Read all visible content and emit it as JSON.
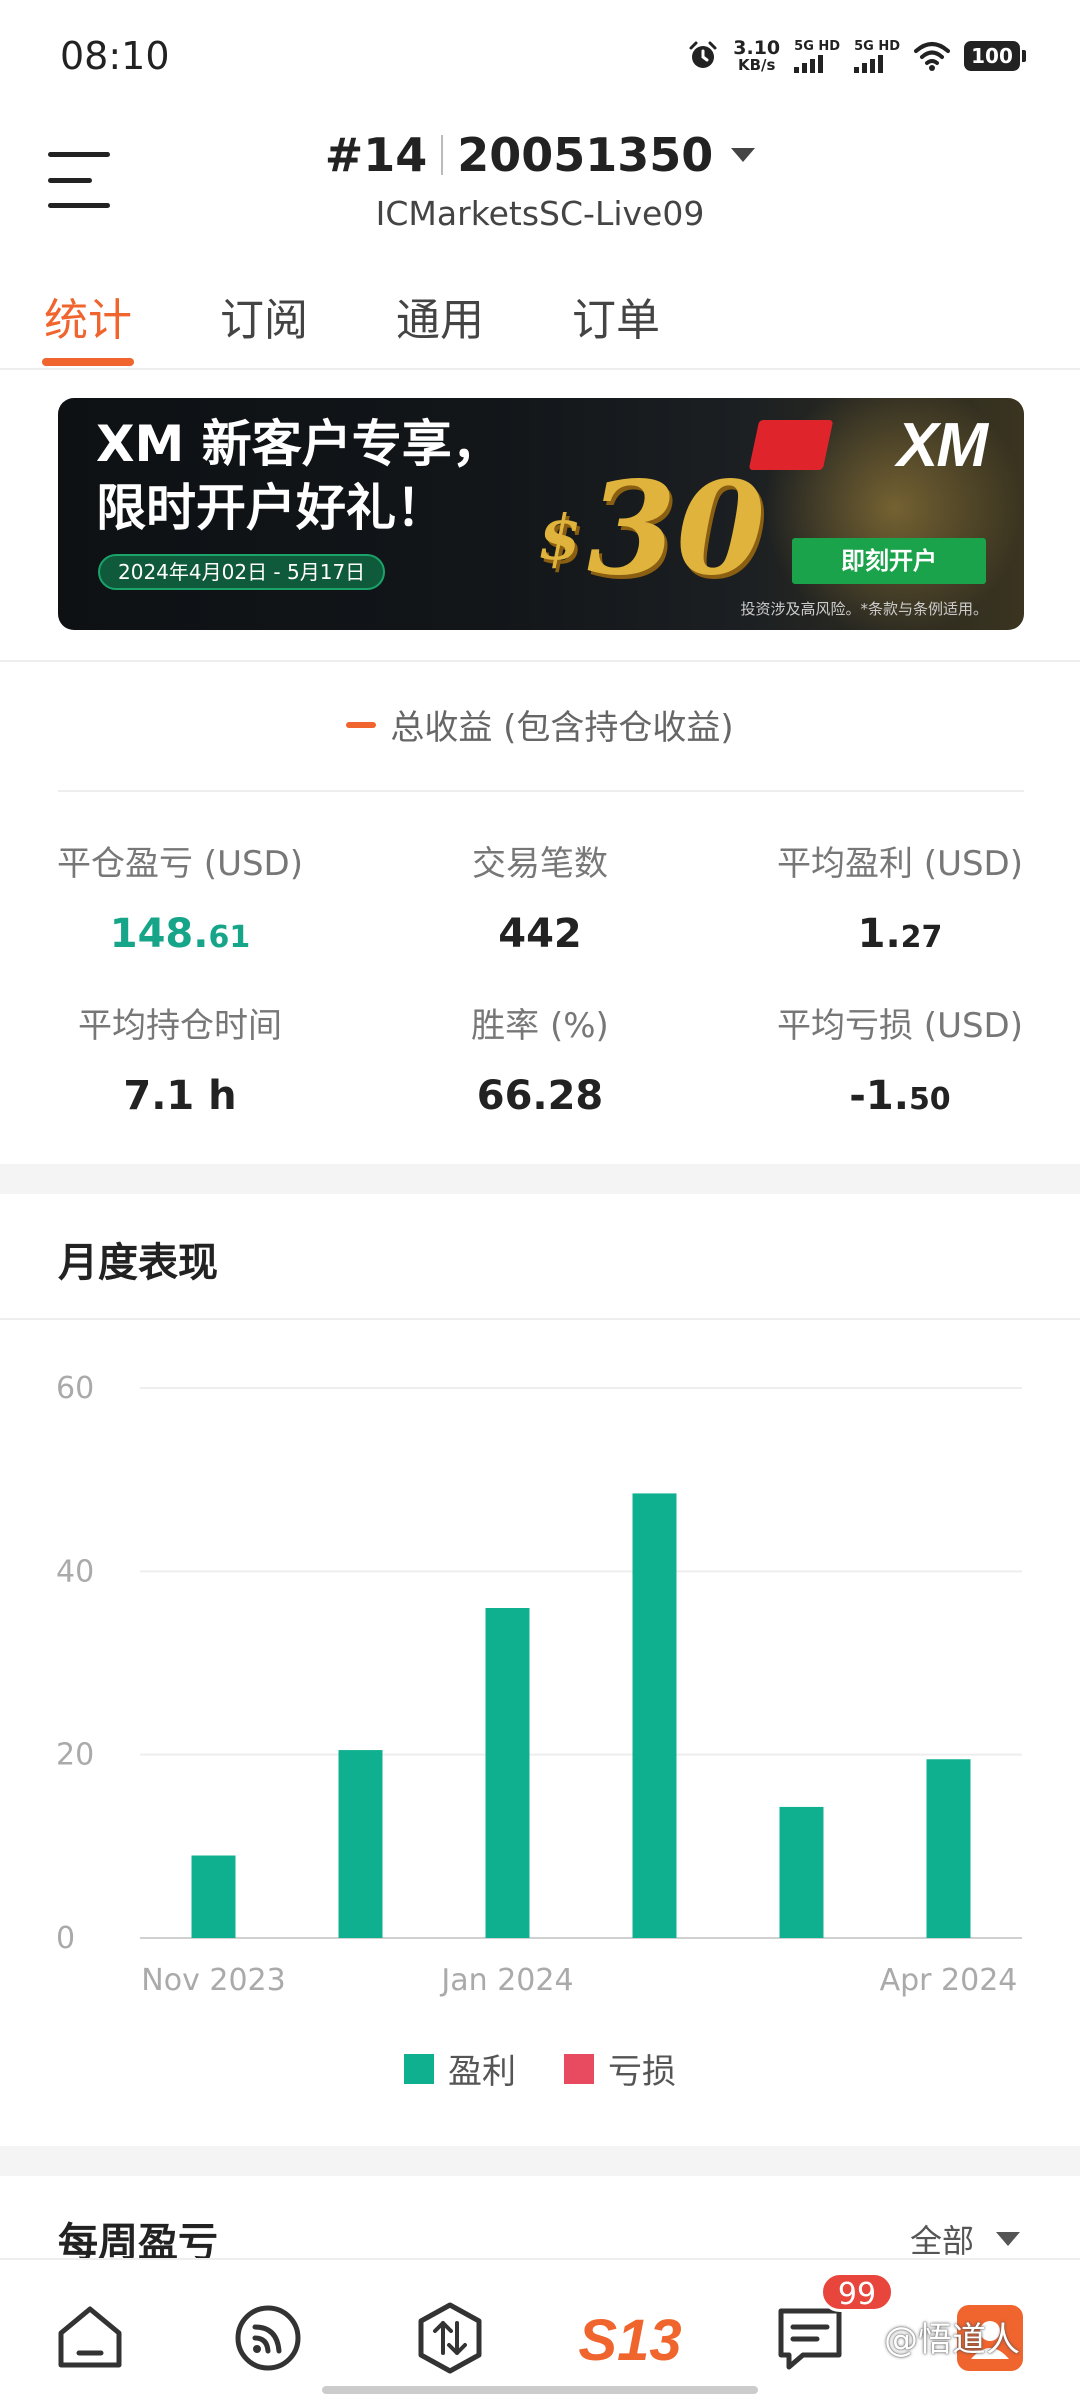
{
  "status_bar": {
    "time": "08:10",
    "speed_value": "3.10",
    "speed_unit": "KB/s",
    "net1": "5G HD",
    "net2": "5G HD",
    "battery": "100",
    "icons": [
      "alarm-icon",
      "signal-icon",
      "wifi-icon",
      "battery-icon"
    ]
  },
  "header": {
    "account_index": "#14",
    "account_number": "20051350",
    "server": "ICMarketsSC-Live09"
  },
  "tabs": [
    {
      "label": "统计",
      "active": true
    },
    {
      "label": "订阅",
      "active": false
    },
    {
      "label": "通用",
      "active": false
    },
    {
      "label": "订单",
      "active": false
    }
  ],
  "banner": {
    "headline_1": "XM 新客户专享，",
    "headline_2": "限时开户好礼！",
    "date_range": "2024年4月02日 - 5月17日",
    "currency": "$",
    "amount": "30",
    "brand": "XM",
    "cta": "即刻开户",
    "disclaimer": "投资涉及高风险。*条款与条例适用。"
  },
  "total_legend": "总收益 (包含持仓收益)",
  "stats": {
    "closed_pl_label": "平仓盈亏 (USD)",
    "closed_pl_int": "148.",
    "closed_pl_dec": "61",
    "trades_label": "交易笔数",
    "trades_value": "442",
    "avg_profit_label": "平均盈利 (USD)",
    "avg_profit_int": "1.",
    "avg_profit_dec": "27",
    "avg_hold_label": "平均持仓时间",
    "avg_hold_value": "7.1 h",
    "win_rate_label": "胜率 (%)",
    "win_rate_value": "66.28",
    "avg_loss_label": "平均亏损 (USD)",
    "avg_loss_int": "-1.",
    "avg_loss_dec": "50"
  },
  "monthly": {
    "title": "月度表现"
  },
  "chart_data": {
    "type": "bar",
    "categories": [
      "Nov 2023",
      "Dec 2023",
      "Jan 2024",
      "Feb 2024",
      "Mar 2024",
      "Apr 2024"
    ],
    "x_tick_labels": [
      "Nov 2023",
      "",
      "Jan 2024",
      "",
      "",
      "Apr 2024"
    ],
    "series": [
      {
        "name": "盈利",
        "color": "#0fb08f",
        "values": [
          9,
          20.5,
          36,
          48.5,
          14.3,
          19.5
        ]
      },
      {
        "name": "亏损",
        "color": "#e84a5f",
        "values": [
          0,
          0,
          0,
          0,
          0,
          0
        ]
      }
    ],
    "y_ticks": [
      0,
      20,
      40,
      60
    ],
    "ylim": [
      0,
      60
    ],
    "grid": true,
    "legend_position": "bottom"
  },
  "weekly": {
    "title": "每周盈亏",
    "filter_label": "全部"
  },
  "bottom_nav": {
    "items": [
      "home-icon",
      "feed-icon",
      "trade-icon",
      "s13-logo",
      "messages-icon",
      "profile-icon"
    ],
    "logo_text": "S13",
    "badge_count": "99",
    "primary_color": "#f0642e"
  },
  "watermark": "@悟道人"
}
